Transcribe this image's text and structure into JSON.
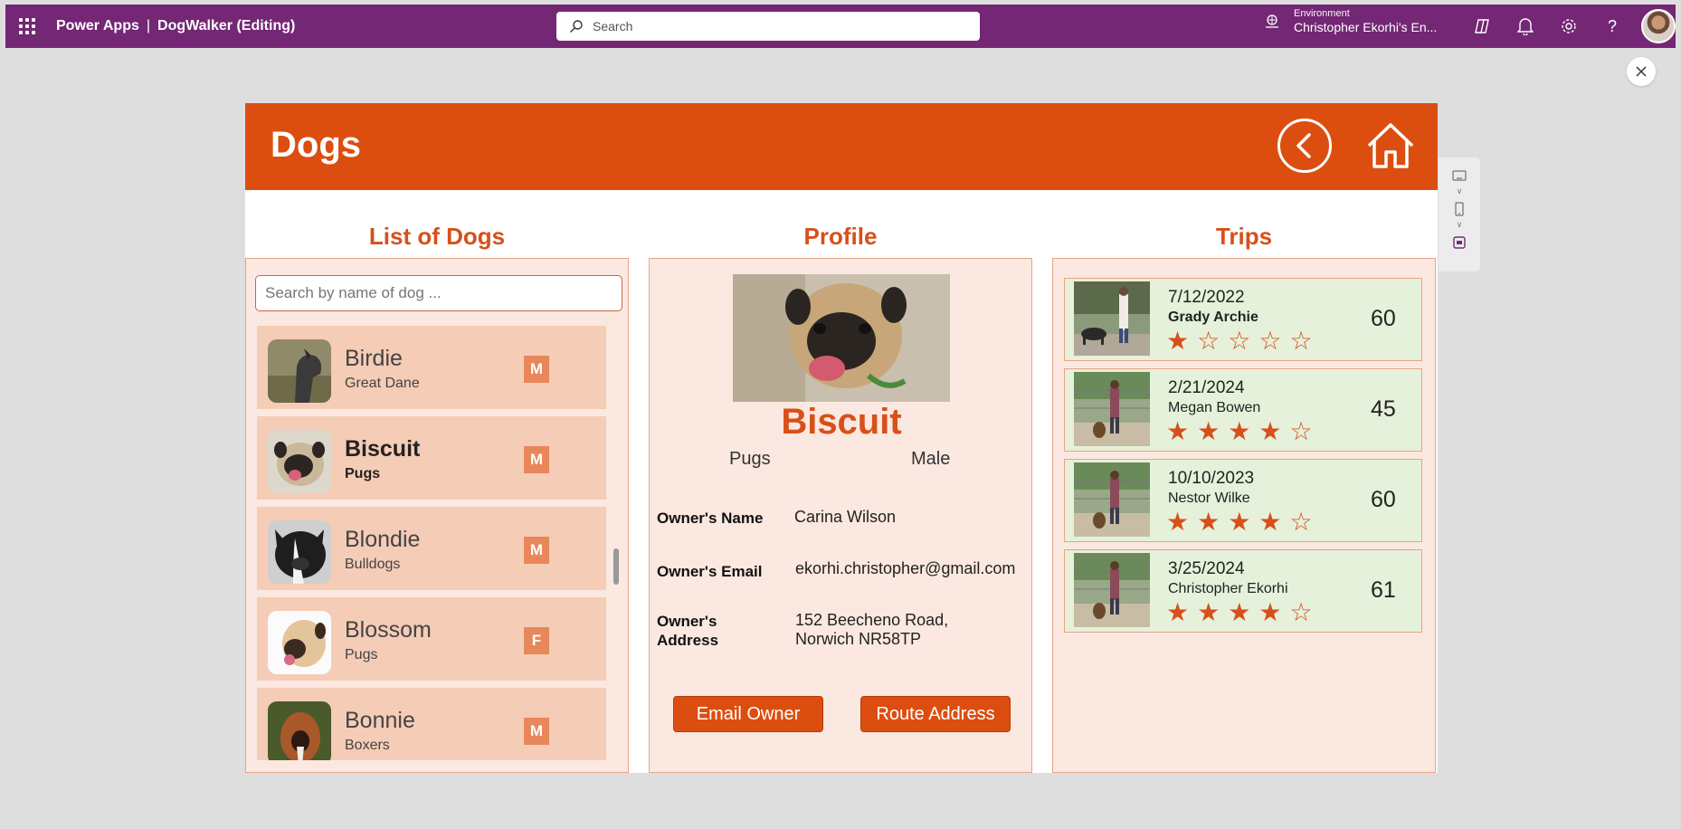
{
  "topbar": {
    "app_name": "Power Apps",
    "separator": "|",
    "document": "DogWalker (Editing)",
    "search_placeholder": "Search",
    "environment_label": "Environment",
    "environment_name": "Christopher Ekorhi's En..."
  },
  "app": {
    "title": "Dogs",
    "sections": {
      "list": "List of Dogs",
      "profile": "Profile",
      "trips": "Trips"
    },
    "list_search_placeholder": "Search by name of dog ...",
    "dogs": [
      {
        "name": "Birdie",
        "breed": "Great Dane",
        "sex": "M",
        "selected": false
      },
      {
        "name": "Biscuit",
        "breed": "Pugs",
        "sex": "M",
        "selected": true
      },
      {
        "name": "Blondie",
        "breed": "Bulldogs",
        "sex": "M",
        "selected": false
      },
      {
        "name": "Blossom",
        "breed": "Pugs",
        "sex": "F",
        "selected": false
      },
      {
        "name": "Bonnie",
        "breed": "Boxers",
        "sex": "M",
        "selected": false
      }
    ],
    "profile": {
      "name": "Biscuit",
      "breed": "Pugs",
      "sex": "Male",
      "owner_name_label": "Owner's Name",
      "owner_name": "Carina Wilson",
      "owner_email_label": "Owner's Email",
      "owner_email": "ekorhi.christopher@gmail.com",
      "owner_address_label_1": "Owner's",
      "owner_address_label_2": "Address",
      "owner_address_1": "152 Beecheno Road,",
      "owner_address_2": "Norwich NR58TP",
      "email_button": "Email Owner",
      "route_button": "Route Address"
    },
    "trips": [
      {
        "date": "7/12/2022",
        "walker": "Grady Archie",
        "rating": 1,
        "minutes": "60"
      },
      {
        "date": "2/21/2024",
        "walker": "Megan Bowen",
        "rating": 4,
        "minutes": "45"
      },
      {
        "date": "10/10/2023",
        "walker": "Nestor Wilke",
        "rating": 4,
        "minutes": "60"
      },
      {
        "date": "3/25/2024",
        "walker": "Christopher Ekorhi",
        "rating": 4,
        "minutes": "61"
      }
    ]
  },
  "colors": {
    "topbar": "#742774",
    "accent": "#dc4e10",
    "row": "#f5ccb6",
    "trip_row": "#e5f1da"
  }
}
